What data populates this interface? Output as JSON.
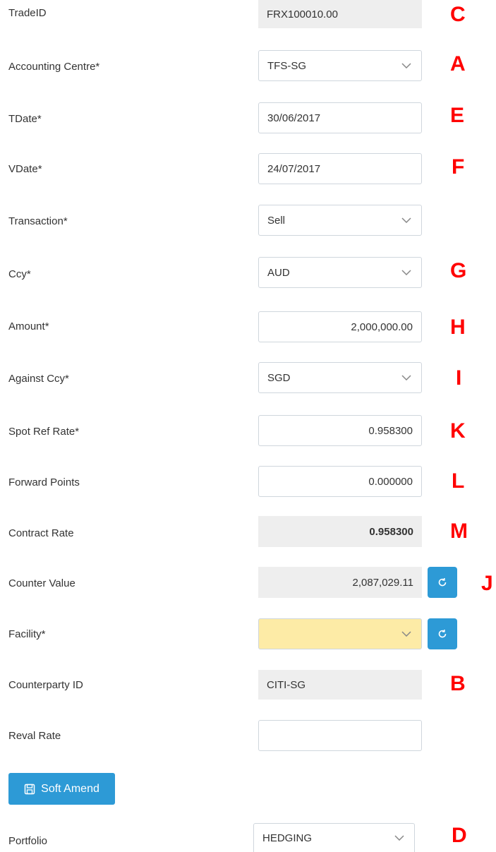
{
  "form": {
    "trade_id": {
      "label": "TradeID",
      "value": "FRX100010.00",
      "marker": "C"
    },
    "accounting_centre": {
      "label": "Accounting Centre*",
      "value": "TFS-SG",
      "marker": "A"
    },
    "tdate": {
      "label": "TDate*",
      "value": "30/06/2017",
      "marker": "E"
    },
    "vdate": {
      "label": "VDate*",
      "value": "24/07/2017",
      "marker": "F"
    },
    "transaction": {
      "label": "Transaction*",
      "value": "Sell"
    },
    "ccy": {
      "label": "Ccy*",
      "value": "AUD",
      "marker": "G"
    },
    "amount": {
      "label": "Amount*",
      "value": "2,000,000.00",
      "marker": "H"
    },
    "against_ccy": {
      "label": "Against Ccy*",
      "value": "SGD",
      "marker": "I"
    },
    "spot_ref_rate": {
      "label": "Spot Ref Rate*",
      "value": "0.958300",
      "marker": "K"
    },
    "forward_points": {
      "label": "Forward Points",
      "value": "0.000000",
      "marker": "L"
    },
    "contract_rate": {
      "label": "Contract Rate",
      "value": "0.958300",
      "marker": "M"
    },
    "counter_value": {
      "label": "Counter Value",
      "value": "2,087,029.11",
      "marker": "J"
    },
    "facility": {
      "label": "Facility*",
      "value": ""
    },
    "counterparty_id": {
      "label": "Counterparty ID",
      "value": "CITI-SG",
      "marker": "B"
    },
    "reval_rate": {
      "label": "Reval Rate",
      "value": ""
    },
    "portfolio": {
      "label": "Portfolio",
      "value": "HEDGING",
      "marker": "D"
    }
  },
  "buttons": {
    "soft_amend": "Soft Amend"
  },
  "icons": {
    "dropdown": "chevron-down-icon",
    "refresh": "refresh-icon",
    "save": "save-icon"
  },
  "colors": {
    "accent": "#2d9ad6",
    "marker": "#ff0000",
    "facility_highlight": "#fdeba6",
    "readonly": "#eeeeee"
  }
}
